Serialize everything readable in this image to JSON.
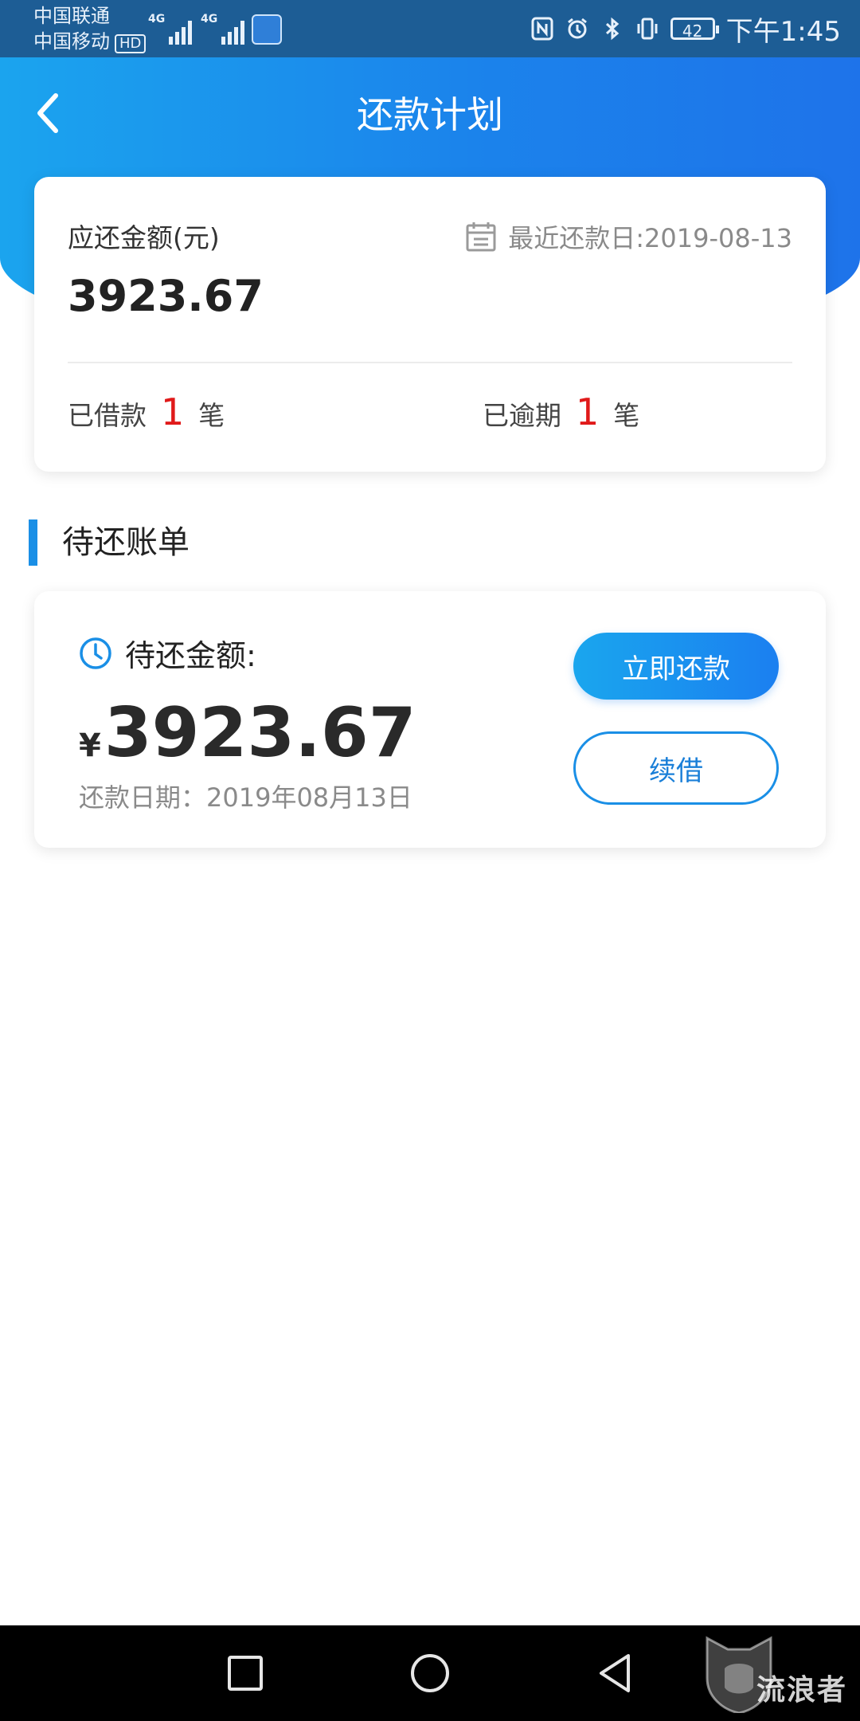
{
  "status_bar": {
    "carrier_1": "中国联通",
    "carrier_2": "中国移动",
    "hd_badge": "HD",
    "network_1": "4G",
    "network_2": "4G",
    "battery_level": "42",
    "time": "下午1:45"
  },
  "header": {
    "title": "还款计划"
  },
  "summary": {
    "due_label": "应还金额(元)",
    "due_amount": "3923.67",
    "recent_date_label": "最近还款日:2019-08-13",
    "borrowed_prefix": "已借款",
    "borrowed_count": "1",
    "borrowed_unit": "笔",
    "overdue_prefix": "已逾期",
    "overdue_count": "1",
    "overdue_unit": "笔"
  },
  "section": {
    "title": "待还账单"
  },
  "bill": {
    "pending_label": "待还金额:",
    "currency": "¥",
    "amount": "3923.67",
    "date_label": "还款日期：2019年08月13日",
    "repay_button": "立即还款",
    "renew_button": "续借"
  },
  "watermark": {
    "text": "流浪者"
  },
  "colors": {
    "primary": "#1a8fe6",
    "status_bar": "#1d5d95",
    "count_red": "#e01a1a"
  }
}
